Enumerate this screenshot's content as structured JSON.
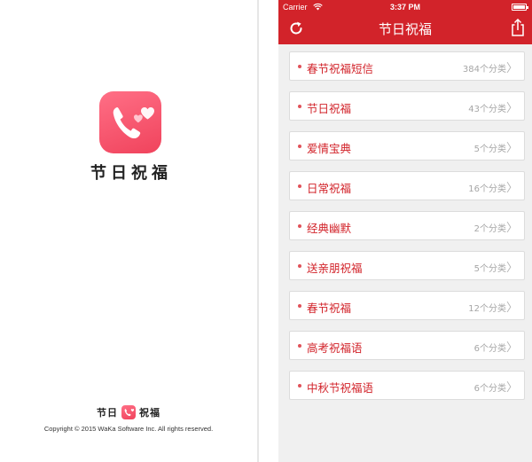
{
  "splash": {
    "app_name": "节日祝福",
    "footer_left": "节日",
    "footer_right": "祝福",
    "copyright": "Copyright © 2015 WaKa Software Inc. All rights reserved."
  },
  "status_bar": {
    "carrier": "Carrier",
    "time": "3:37 PM"
  },
  "nav": {
    "title": "节日祝福",
    "refresh_icon": "refresh-icon",
    "share_icon": "share-icon"
  },
  "categories": [
    {
      "title": "春节祝福短信",
      "count": "384个分类"
    },
    {
      "title": "节日祝福",
      "count": "43个分类"
    },
    {
      "title": "爱情宝典",
      "count": "5个分类"
    },
    {
      "title": "日常祝福",
      "count": "16个分类"
    },
    {
      "title": "经典幽默",
      "count": "2个分类"
    },
    {
      "title": "送亲朋祝福",
      "count": "5个分类"
    },
    {
      "title": "春节祝福",
      "count": "12个分类"
    },
    {
      "title": "高考祝福语",
      "count": "6个分类"
    },
    {
      "title": "中秋节祝福语",
      "count": "6个分类"
    }
  ],
  "colors": {
    "brand_red": "#d2232a",
    "icon_pink": "#f0435c",
    "count_gray": "#a6a6a6"
  }
}
